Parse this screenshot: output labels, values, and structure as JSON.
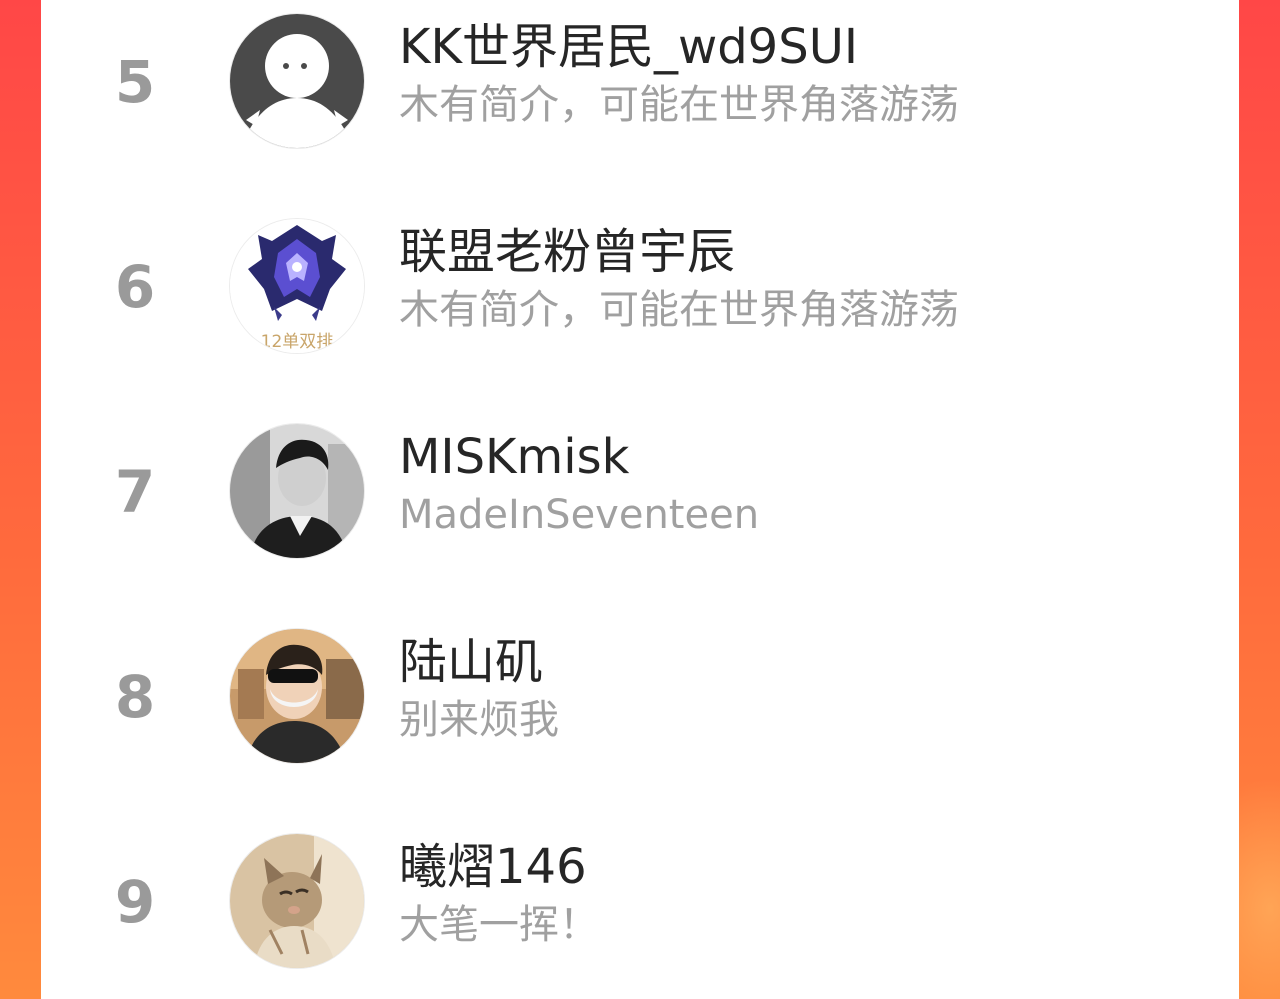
{
  "ranking": {
    "users": [
      {
        "rank": "5",
        "name": "KK世界居民_wd9SUI",
        "bio": "木有简介，可能在世界角落游荡",
        "avatar_icon": "default-ghost-avatar-icon"
      },
      {
        "rank": "6",
        "name": "联盟老粉曾宇辰",
        "bio": "木有简介，可能在世界角落游荡",
        "avatar_icon": "game-rank-emblem-avatar",
        "avatar_caption": "12单双排"
      },
      {
        "rank": "7",
        "name": "MISKmisk",
        "bio": "MadeInSeventeen",
        "avatar_icon": "person-photo-avatar"
      },
      {
        "rank": "8",
        "name": "陆山矶",
        "bio": "别来烦我",
        "avatar_icon": "person-mask-photo-avatar"
      },
      {
        "rank": "9",
        "name": "曦熠146",
        "bio": "大笔一挥！",
        "avatar_icon": "cat-photo-avatar"
      }
    ]
  },
  "colors": {
    "accent_gradient_top": "#ff4747",
    "accent_gradient_bottom": "#ff8a3d",
    "rank_text": "#9a9a9a",
    "name_text": "#262626",
    "bio_text": "#a0a0a0"
  }
}
